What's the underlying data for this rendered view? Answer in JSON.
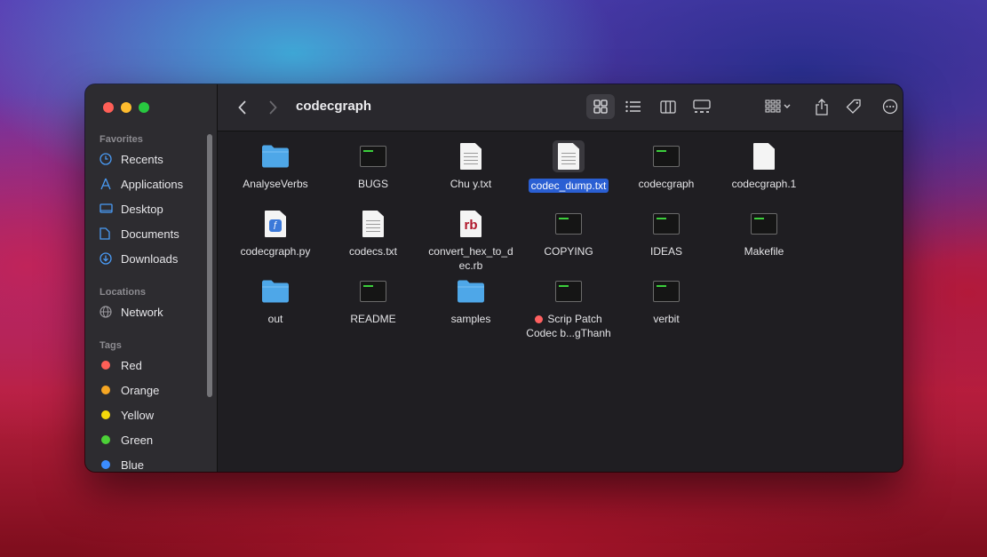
{
  "window": {
    "title": "codecgraph"
  },
  "sidebar": {
    "favorites_title": "Favorites",
    "favorites": [
      {
        "label": "Recents",
        "icon": "clock-icon"
      },
      {
        "label": "Applications",
        "icon": "applications-icon"
      },
      {
        "label": "Desktop",
        "icon": "desktop-icon"
      },
      {
        "label": "Documents",
        "icon": "document-icon"
      },
      {
        "label": "Downloads",
        "icon": "download-icon"
      }
    ],
    "locations_title": "Locations",
    "locations": [
      {
        "label": "Network",
        "icon": "globe-icon"
      }
    ],
    "tags_title": "Tags",
    "tags": [
      {
        "label": "Red",
        "color": "#ff5f57"
      },
      {
        "label": "Orange",
        "color": "#f5a623"
      },
      {
        "label": "Yellow",
        "color": "#f5d90a"
      },
      {
        "label": "Green",
        "color": "#4cd137"
      },
      {
        "label": "Blue",
        "color": "#3b8cff"
      }
    ]
  },
  "toolbar": {
    "back": "‹",
    "forward": "›",
    "icons": [
      "back-icon",
      "forward-icon",
      "icon-view-icon",
      "list-view-icon",
      "column-view-icon",
      "gallery-view-icon",
      "group-icon",
      "share-icon",
      "tag-icon",
      "more-icon",
      "search-icon"
    ]
  },
  "files": [
    {
      "name": "AnalyseVerbs",
      "kind": "folder"
    },
    {
      "name": "BUGS",
      "kind": "exec"
    },
    {
      "name": "Chu y.txt",
      "kind": "text"
    },
    {
      "name": "codec_dump.txt",
      "kind": "text",
      "selected": true
    },
    {
      "name": "codecgraph",
      "kind": "exec"
    },
    {
      "name": "codecgraph.1",
      "kind": "blank"
    },
    {
      "name": "codecgraph.py",
      "kind": "python"
    },
    {
      "name": "codecs.txt",
      "kind": "text"
    },
    {
      "name": "convert_hex_to_dec.rb",
      "line1": "convert_hex_to_d",
      "line2": "ec.rb",
      "kind": "ruby",
      "badge": "rb"
    },
    {
      "name": "COPYING",
      "kind": "exec"
    },
    {
      "name": "IDEAS",
      "kind": "exec"
    },
    {
      "name": "Makefile",
      "kind": "exec"
    },
    {
      "name": "out",
      "kind": "folder"
    },
    {
      "name": "README",
      "kind": "exec"
    },
    {
      "name": "samples",
      "kind": "folder"
    },
    {
      "name": "Scrip Patch Codec b...gThanh",
      "line1": "Scrip Patch",
      "line2": "Codec b...gThanh",
      "kind": "exec",
      "tag_color": "#ff6060"
    },
    {
      "name": "verbit",
      "kind": "exec"
    }
  ],
  "colors": {
    "accent": "#2a5fd3",
    "folder": "#4ea7e8"
  }
}
